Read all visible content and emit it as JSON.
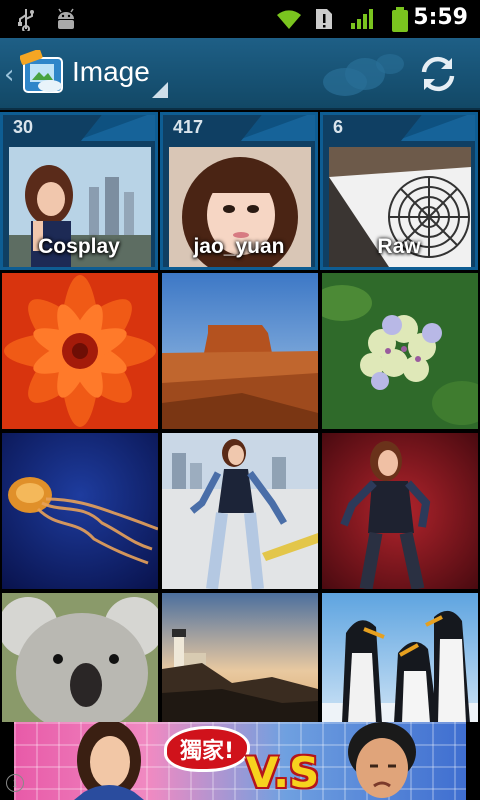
{
  "status_bar": {
    "time": "5:59",
    "icons": [
      "usb-icon",
      "android-debug-icon",
      "wifi-icon",
      "sim-alert-icon",
      "signal-icon",
      "battery-icon"
    ]
  },
  "action_bar": {
    "title": "Image",
    "icons": [
      "back-chevron-icon",
      "app-logo-icon",
      "dropdown-icon",
      "refresh-icon"
    ]
  },
  "albums": [
    {
      "count": "30",
      "label": "Cosplay"
    },
    {
      "count": "417",
      "label": "jao_yuan"
    },
    {
      "count": "6",
      "label": "Raw"
    }
  ],
  "photos": [
    "chrysanthemum",
    "desert",
    "hydrangeas",
    "jellyfish",
    "cosplay-white",
    "cosplay-red",
    "koala",
    "lighthouse",
    "penguins"
  ],
  "ad": {
    "badge_text": "獨家!",
    "vs_text": "V.S",
    "info_glyph": "i"
  },
  "colors": {
    "action_bar": "#1e5f86",
    "album_border": "#0e5d93",
    "album_bg": "#0f3f63",
    "signal": "#7ac41f"
  }
}
